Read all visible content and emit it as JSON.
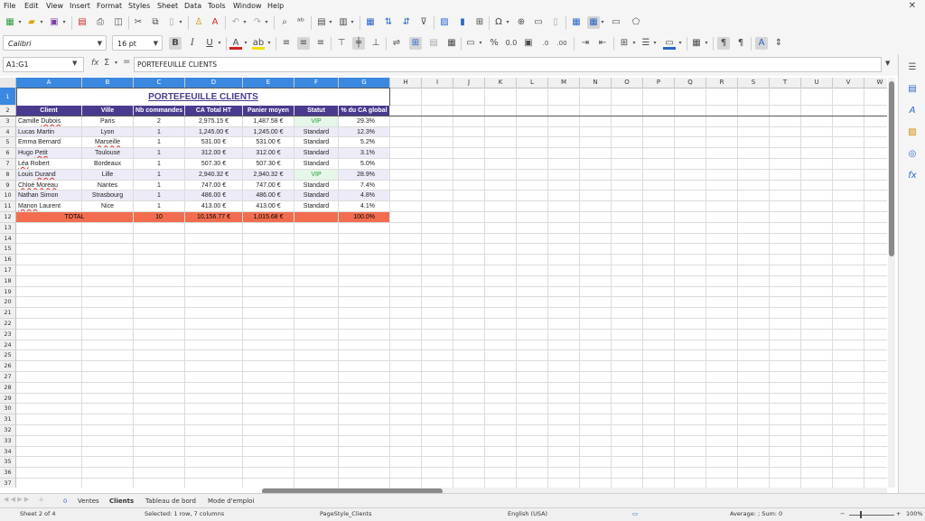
{
  "menu": [
    "File",
    "Edit",
    "View",
    "Insert",
    "Format",
    "Styles",
    "Sheet",
    "Data",
    "Tools",
    "Window",
    "Help"
  ],
  "font": {
    "name": "Calibri",
    "size": "16 pt"
  },
  "namebox": "A1:G1",
  "formula": "PORTEFEUILLE CLIENTS",
  "columns": [
    "A",
    "B",
    "C",
    "D",
    "E",
    "F",
    "G",
    "H",
    "I",
    "J",
    "K",
    "L",
    "M",
    "N",
    "O",
    "P",
    "Q",
    "R",
    "S",
    "T",
    "U",
    "V",
    "W"
  ],
  "sheet_title": "PORTEFEUILLE CLIENTS",
  "headers": [
    "Client",
    "Ville",
    "Nb commandes",
    "CA Total HT",
    "Panier moyen",
    "Statut",
    "% du CA global"
  ],
  "rows": [
    {
      "client": "Camille Dubois",
      "ville": "Paris",
      "nb": "2",
      "ca": "2,975.15 €",
      "panier": "1,487.58 €",
      "statut": "VIP",
      "pct": "29.3%"
    },
    {
      "client": "Lucas Martin",
      "ville": "Lyon",
      "nb": "1",
      "ca": "1,245.00 €",
      "panier": "1,245.00 €",
      "statut": "Standard",
      "pct": "12.3%"
    },
    {
      "client": "Emma Bernard",
      "ville": "Marseille",
      "nb": "1",
      "ca": "531.00 €",
      "panier": "531.00 €",
      "statut": "Standard",
      "pct": "5.2%"
    },
    {
      "client": "Hugo Petit",
      "ville": "Toulouse",
      "nb": "1",
      "ca": "312.00 €",
      "panier": "312.00 €",
      "statut": "Standard",
      "pct": "3.1%"
    },
    {
      "client": "Léa Robert",
      "ville": "Bordeaux",
      "nb": "1",
      "ca": "507.30 €",
      "panier": "507.30 €",
      "statut": "Standard",
      "pct": "5.0%"
    },
    {
      "client": "Louis Durand",
      "ville": "Lille",
      "nb": "1",
      "ca": "2,940.32 €",
      "panier": "2,940.32 €",
      "statut": "VIP",
      "pct": "28.9%"
    },
    {
      "client": "Chloé Moreau",
      "ville": "Nantes",
      "nb": "1",
      "ca": "747.00 €",
      "panier": "747.00 €",
      "statut": "Standard",
      "pct": "7.4%"
    },
    {
      "client": "Nathan Simon",
      "ville": "Strasbourg",
      "nb": "1",
      "ca": "486.00 €",
      "panier": "486.00 €",
      "statut": "Standard",
      "pct": "4.8%"
    },
    {
      "client": "Manon Laurent",
      "ville": "Nice",
      "nb": "1",
      "ca": "413.00 €",
      "panier": "413.00 €",
      "statut": "Standard",
      "pct": "4.1%"
    }
  ],
  "total": {
    "label": "TOTAL",
    "nb": "10",
    "ca": "10,156.77 €",
    "panier": "1,015.68 €",
    "pct": "100.0%"
  },
  "tabs": [
    "Ventes",
    "Clients",
    "Tableau de bord",
    "Mode d'emploi"
  ],
  "tab_counter": "0",
  "status": {
    "sheet": "Sheet 2 of 4",
    "selected": "Selected: 1 row, 7 columns",
    "pagestyle": "PageStyle_Clients",
    "lang": "English (USA)",
    "sum": "Average: ; Sum: 0",
    "zoom": "100%"
  },
  "colors": {
    "header_bg": "#4a3a8e",
    "alt_row": "#ecebf7",
    "vip_text": "#1e9a34",
    "total_bg": "#f26d4f",
    "selection": "#3b88e0"
  }
}
